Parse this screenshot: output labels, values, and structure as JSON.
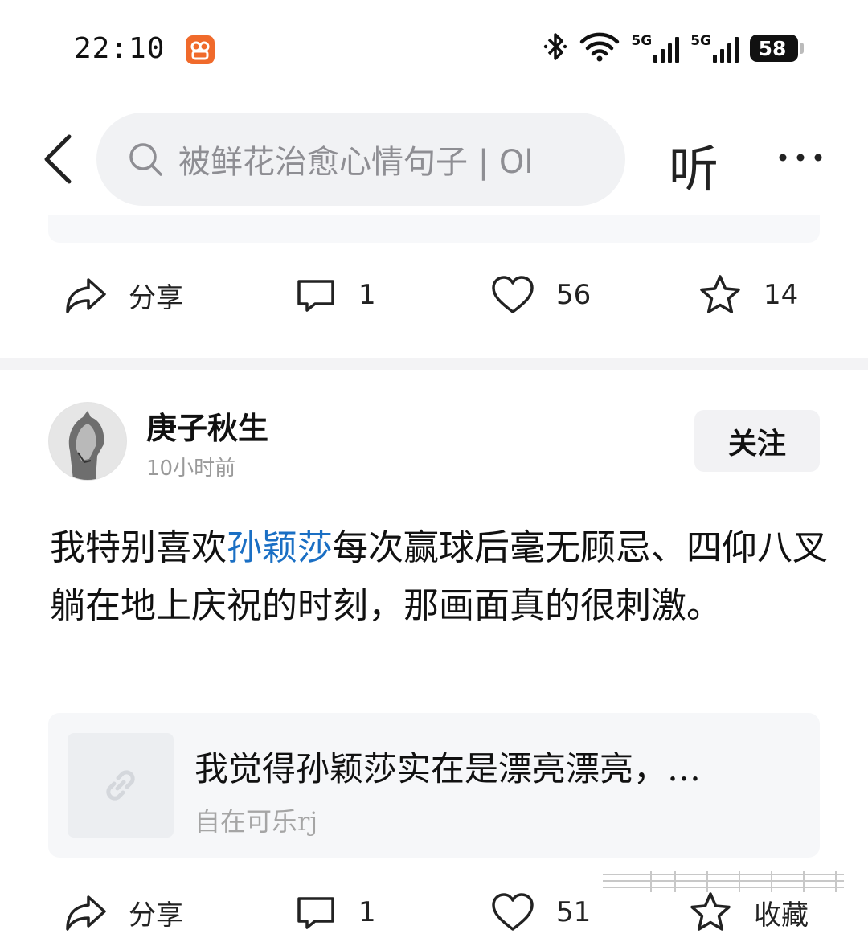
{
  "status_bar": {
    "time": "22:10",
    "app_icon": "bilibili-style-app-icon",
    "icons": [
      "bluetooth-icon",
      "wifi-icon",
      "signal-5g-icon",
      "signal-5g-icon"
    ],
    "network_labels": [
      "5G",
      "5G"
    ],
    "battery": "58"
  },
  "header": {
    "search_text": "被鲜花治愈心情句子 | Ol",
    "listen_label": "听"
  },
  "top_post_actions": {
    "share_label": "分享",
    "comment_count": "1",
    "like_count": "56",
    "favorite_count": "14"
  },
  "post": {
    "author_name": "庚子秋生",
    "time_ago": "10小时前",
    "follow_label": "关注",
    "body": {
      "before": "我特别喜欢",
      "highlight": "孙颖莎",
      "after": "每次赢球后毫无顾忌、四仰八叉躺在地上庆祝的时刻，那画面真的很刺激。"
    },
    "link_card": {
      "title": "我觉得孙颖莎实在是漂亮漂亮，…",
      "author": "自在可乐rj"
    },
    "actions": {
      "share_label": "分享",
      "comment_count": "1",
      "like_count": "51",
      "favorite_label": "收藏"
    }
  },
  "colors": {
    "accent_link": "#1a6fc4",
    "app_badge": "#f06a2b",
    "divider": "#f3f3f5"
  }
}
